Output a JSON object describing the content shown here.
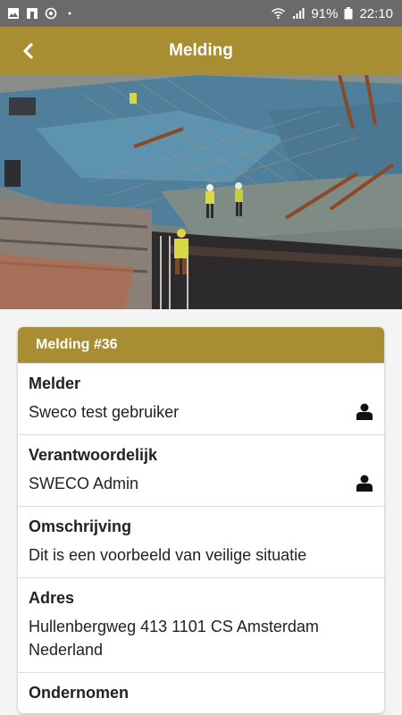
{
  "statusbar": {
    "battery_percent": "91%",
    "time": "22:10",
    "icons": [
      "image-icon",
      "flipboard-icon",
      "sync-icon",
      "dot-icon",
      "wifi-icon",
      "signal-icon",
      "battery-icon"
    ]
  },
  "appbar": {
    "title": "Melding",
    "back_icon": "back-chevron-icon"
  },
  "hero": {
    "image": "construction-site-photo"
  },
  "card": {
    "header": "Melding #36",
    "rows": [
      {
        "label": "Melder",
        "value": "Sweco test gebruiker",
        "icon": "person-icon"
      },
      {
        "label": "Verantwoordelijk",
        "value": "SWECO Admin",
        "icon": "person-icon"
      },
      {
        "label": "Omschrijving",
        "value": "Dit is een voorbeeld van veilige situatie"
      },
      {
        "label": "Adres",
        "value": "Hullenbergweg 413 1101 CS Amsterdam Nederland"
      },
      {
        "label": "Ondernomen"
      }
    ]
  },
  "colors": {
    "accent": "#a88d33",
    "statusbar": "#6a6a6a"
  }
}
